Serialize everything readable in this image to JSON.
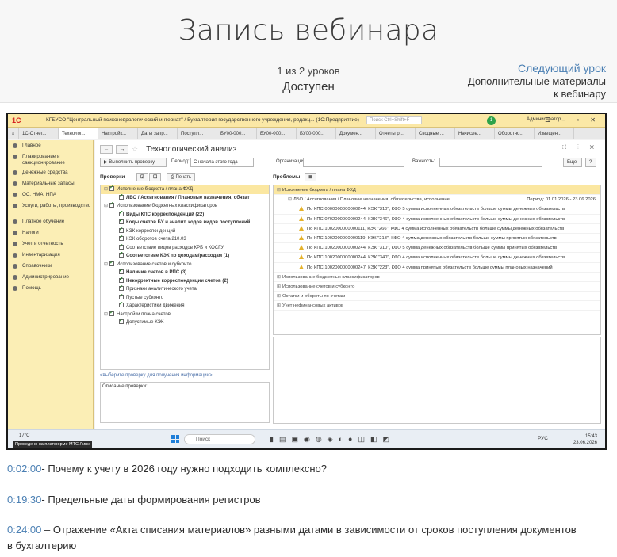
{
  "header": {
    "title": "Запись вебинара",
    "progress": "1 из 2 уроков",
    "status": "Доступен",
    "next_label": "Следующий урок",
    "next_sub_line1": "Дополнительные материалы",
    "next_sub_line2": "к вебинару"
  },
  "video": {
    "window_title": "КГБУСО \"Центральный психоневрологический интернат\" / Бухгалтерия государственного учреждения, редакц...  (1С:Предприятие)",
    "search_placeholder": "Поиск Ctrl+Shift+F",
    "badge_count": "1",
    "user": "Администратор",
    "tabs": [
      "1С-Отчет...",
      "Технолог...",
      "Настройк...",
      "Даты запр...",
      "Поступл...",
      "БУ00-000...",
      "БУ00-000...",
      "БУ00-000...",
      "Докумен...",
      "Отчеты р...",
      "Сводные ...",
      "Начисле...",
      "Оборотно...",
      "Извещен..."
    ],
    "sidebar": [
      {
        "label": "Главное",
        "tall": false
      },
      {
        "label": "Планирование и санкционирование",
        "tall": true
      },
      {
        "label": "Денежные средства",
        "tall": false
      },
      {
        "label": "Материальные запасы",
        "tall": false
      },
      {
        "label": "ОС, НМА, НПА",
        "tall": false
      },
      {
        "label": "Услуги, работы, производство",
        "tall": true
      },
      {
        "label": "Платное обучение",
        "tall": false
      },
      {
        "label": "Налоги",
        "tall": false
      },
      {
        "label": "Учет и отчетность",
        "tall": false
      },
      {
        "label": "Инвентаризация",
        "tall": false
      },
      {
        "label": "Справочники",
        "tall": false
      },
      {
        "label": "Администрирование",
        "tall": false
      },
      {
        "label": "Помощь",
        "tall": false
      }
    ],
    "page_title": "Технологический анализ",
    "toolbar": {
      "run_check": "Выполнить проверку",
      "period_label": "Период:",
      "period_value": "С начала этого года",
      "org_label": "Организация:",
      "importance_label": "Важность:",
      "more": "Еще",
      "help": "?"
    },
    "checks_label": "Проверки",
    "print_label": "Печать",
    "problems_label": "Проблемы",
    "checks_tree": [
      {
        "label": "Исполнение бюджета / плана ФХД",
        "indent": 0,
        "bold": false,
        "sel": true,
        "exp": "⊟"
      },
      {
        "label": "ЛБО / Ассигнования / Плановые назначения, обязат",
        "indent": 1,
        "bold": true,
        "sel": false,
        "exp": ""
      },
      {
        "label": "Использование бюджетных классификаторов",
        "indent": 0,
        "bold": false,
        "sel": false,
        "exp": "⊟"
      },
      {
        "label": "Виды КПС корреспонденций (22)",
        "indent": 1,
        "bold": true,
        "sel": false,
        "exp": ""
      },
      {
        "label": "Коды счетов БУ и аналит. кодов видов поступлений",
        "indent": 1,
        "bold": true,
        "sel": false,
        "exp": ""
      },
      {
        "label": "КЭК корреспонденций",
        "indent": 1,
        "bold": false,
        "sel": false,
        "exp": ""
      },
      {
        "label": "КЭК оборотов счета 210.03",
        "indent": 1,
        "bold": false,
        "sel": false,
        "exp": ""
      },
      {
        "label": "Соответствие видов расходов КРБ и КОСГУ",
        "indent": 1,
        "bold": false,
        "sel": false,
        "exp": ""
      },
      {
        "label": "Соответствие КЭК по доходам/расходам (1)",
        "indent": 1,
        "bold": true,
        "sel": false,
        "exp": ""
      },
      {
        "label": "Использование счетов и субконто",
        "indent": 0,
        "bold": false,
        "sel": false,
        "exp": "⊟"
      },
      {
        "label": "Наличие счетов в РПС (3)",
        "indent": 1,
        "bold": true,
        "sel": false,
        "exp": ""
      },
      {
        "label": "Некорректные корреспонденции счетов (2)",
        "indent": 1,
        "bold": true,
        "sel": false,
        "exp": ""
      },
      {
        "label": "Признаки аналитического учета",
        "indent": 1,
        "bold": false,
        "sel": false,
        "exp": ""
      },
      {
        "label": "Пустые субконто",
        "indent": 1,
        "bold": false,
        "sel": false,
        "exp": ""
      },
      {
        "label": "Характеристики движения",
        "indent": 1,
        "bold": false,
        "sel": false,
        "exp": ""
      },
      {
        "label": "Настройки плана счетов",
        "indent": 0,
        "bold": false,
        "sel": false,
        "exp": "⊟"
      },
      {
        "label": "Допустимые КЭК",
        "indent": 1,
        "bold": false,
        "sel": false,
        "exp": ""
      }
    ],
    "select_link": "<выберите проверку для получения информации>",
    "description_label": "Описание проверки:",
    "problems": [
      {
        "label": "Исполнение бюджета / плана ФХД",
        "kind": "group-sel",
        "indent": 0
      },
      {
        "label": "ЛБО / Ассигнования / Плановые назначения, обязательства, исполнение",
        "kind": "sub",
        "indent": 1,
        "period": "Период: 01.01.2026 - 23.06.2026"
      },
      {
        "label": "По КПС 0000000000000244, КЭК \"310\", КФО 5 сумма исполненных обязательств больше суммы денежных обязательств",
        "kind": "warn",
        "indent": 2
      },
      {
        "label": "По КПС 0702000000000244, КЭК \"346\", КФО 4 сумма исполненных обязательств больше суммы денежных обязательств",
        "kind": "warn",
        "indent": 2
      },
      {
        "label": "По КПС 1002000000000111, КЭК \"266\", КФО 4 сумма исполненных обязательств больше суммы денежных обязательств",
        "kind": "warn",
        "indent": 2
      },
      {
        "label": "По КПС 1002000000000119, КЭК \"213\", КФО 4 сумма денежных обязательств больше суммы принятых обязательств",
        "kind": "warn",
        "indent": 2
      },
      {
        "label": "По КПС 1002000000000244, КЭК \"310\", КФО 5 сумма денежных обязательств больше суммы принятых обязательств",
        "kind": "warn",
        "indent": 2
      },
      {
        "label": "По КПС 1002000000000244, КЭК \"340\", КФО 4 сумма исполненных обязательств больше суммы денежных обязательств",
        "kind": "warn",
        "indent": 2
      },
      {
        "label": "По КПС 1002000000000247, КЭК \"223\", КФО 4 сумма принятых обязательств больше суммы плановых назначений",
        "kind": "warn",
        "indent": 2
      },
      {
        "label": "Использование бюджетных классификаторов",
        "kind": "group",
        "indent": 0
      },
      {
        "label": "Использование счетов и субконто",
        "kind": "group",
        "indent": 0
      },
      {
        "label": "Остатки и обороты по счетам",
        "kind": "group",
        "indent": 0
      },
      {
        "label": "Учет нефинансовых активов",
        "kind": "group",
        "indent": 0
      }
    ],
    "taskbar": {
      "weather": "17°C",
      "banner": "Проведено на платформе МТС Линк",
      "search": "Поиск",
      "lang": "РУС",
      "time": "15:43",
      "date": "23.06.2026"
    }
  },
  "timecodes": [
    {
      "time": "0:02:00",
      "sep": "-",
      "text": " Почему к учету в 2026 году нужно подходить комплексно?"
    },
    {
      "time": "0:19:30",
      "sep": "-",
      "text": " Предельные даты формирования регистров"
    },
    {
      "time": "0:24:00",
      "sep": " –",
      "text": " Отражение «Акта списания материалов» разными датами в зависимости от сроков поступления документов",
      "text2": "в бухгалтерию"
    }
  ]
}
